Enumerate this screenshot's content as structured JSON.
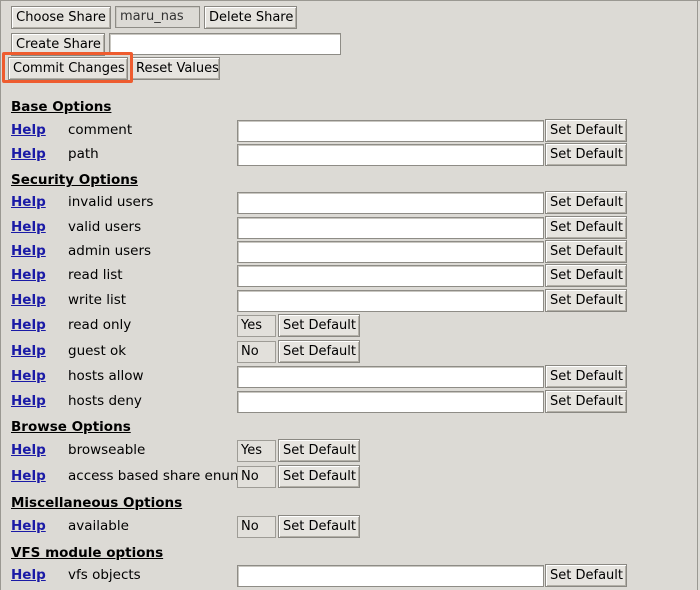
{
  "toolbar": {
    "choose_share_label": "Choose Share",
    "share_name": "maru_nas",
    "delete_share_label": "Delete Share",
    "create_share_label": "Create Share",
    "create_share_value": "",
    "commit_label": "Commit Changes",
    "reset_label": "Reset Values"
  },
  "common": {
    "help_label": "Help",
    "set_default_label": "Set Default"
  },
  "sections": {
    "base": {
      "title": "Base Options",
      "params": [
        {
          "name": "comment",
          "value": ""
        },
        {
          "name": "path",
          "value": ""
        }
      ]
    },
    "security": {
      "title": "Security Options",
      "params": [
        {
          "name": "invalid users",
          "value": ""
        },
        {
          "name": "valid users",
          "value": ""
        },
        {
          "name": "admin users",
          "value": ""
        },
        {
          "name": "read list",
          "value": ""
        },
        {
          "name": "write list",
          "value": ""
        },
        {
          "name": "read only",
          "value": "Yes"
        },
        {
          "name": "guest ok",
          "value": "No"
        },
        {
          "name": "hosts allow",
          "value": ""
        },
        {
          "name": "hosts deny",
          "value": ""
        }
      ]
    },
    "browse": {
      "title": "Browse Options",
      "params": [
        {
          "name": "browseable",
          "value": "Yes"
        },
        {
          "name": "access based share enum",
          "value": "No"
        }
      ]
    },
    "misc": {
      "title": "Miscellaneous Options",
      "params": [
        {
          "name": "available",
          "value": "No"
        }
      ]
    },
    "vfs": {
      "title": "VFS module options",
      "params": [
        {
          "name": "vfs objects",
          "value": ""
        }
      ]
    }
  },
  "colors": {
    "highlight": "#ee5c2f",
    "link": "#1a1aa6",
    "background": "#dcdad5"
  }
}
